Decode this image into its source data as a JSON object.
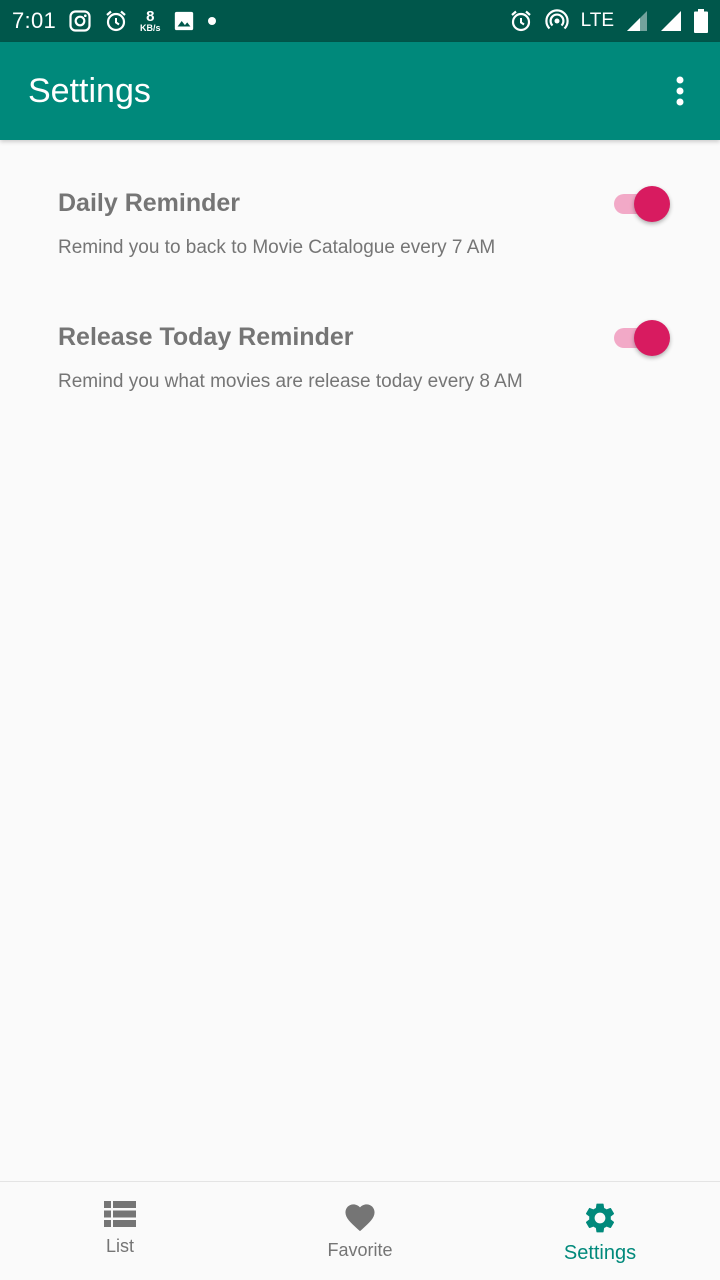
{
  "status_bar": {
    "time": "7:01",
    "speed_value": "8",
    "speed_unit": "KB/s",
    "network": "LTE",
    "icons": [
      "instagram-icon",
      "alarm-icon",
      "image-icon",
      "dot-icon",
      "alarm-icon",
      "hotspot-icon",
      "signal-icon",
      "signal-icon",
      "battery-icon"
    ]
  },
  "app_bar": {
    "title": "Settings",
    "overflow_icon": "more-vert-icon"
  },
  "preferences": [
    {
      "title": "Daily Reminder",
      "summary": "Remind you to back to Movie Catalogue every 7 AM",
      "enabled": true
    },
    {
      "title": "Release Today Reminder",
      "summary": "Remind you what movies are release today every 8 AM",
      "enabled": true
    }
  ],
  "bottom_nav": {
    "items": [
      {
        "label": "List",
        "icon": "list-icon",
        "active": false
      },
      {
        "label": "Favorite",
        "icon": "heart-icon",
        "active": false
      },
      {
        "label": "Settings",
        "icon": "gear-icon",
        "active": true
      }
    ]
  },
  "colors": {
    "status_bar": "#00574b",
    "app_bar": "#00897b",
    "switch_thumb": "#d81b60",
    "switch_track": "#f2a9c7",
    "nav_active": "#00897b",
    "nav_inactive": "#757575"
  }
}
